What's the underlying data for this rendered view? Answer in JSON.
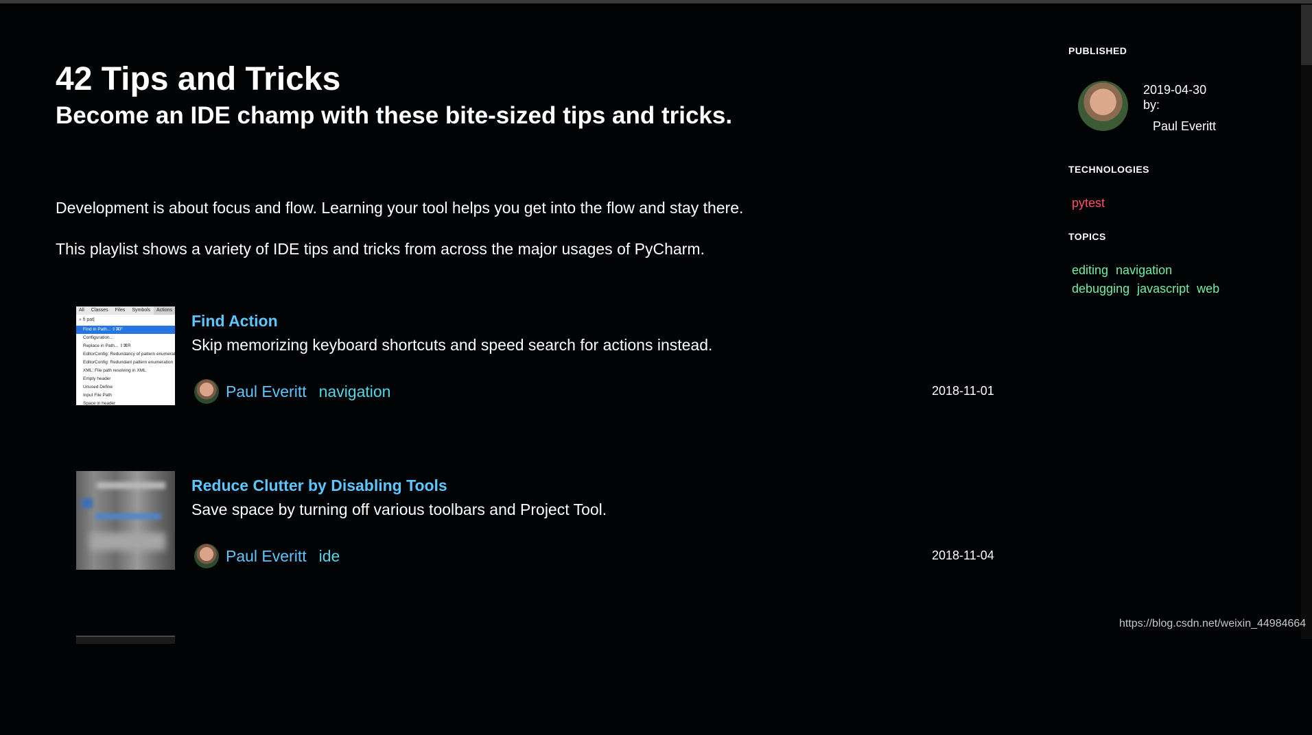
{
  "header": {
    "title": "42 Tips and Tricks",
    "subtitle": "Become an IDE champ with these bite-sized tips and tricks."
  },
  "intro": [
    "Development is about focus and flow. Learning your tool helps you get into the flow and stay there.",
    "This playlist shows a variety of IDE tips and tricks from across the major usages of PyCharm."
  ],
  "tips": [
    {
      "title": "Find Action",
      "description": "Skip memorizing keyboard shortcuts and speed search for actions instead.",
      "author": "Paul Everitt",
      "tag": "navigation",
      "date": "2018-11-01",
      "thumb": {
        "tabs": [
          "All",
          "Classes",
          "Files",
          "Symbols",
          "Actions"
        ],
        "search": "fi pat|",
        "rows": [
          "Find in Path...  ⇧⌘F",
          "Configuration...",
          "Replace in Path...  ⇧⌘R",
          "EditorConfig: Redundancy of pattern enumeration",
          "EditorConfig: Redundant pattern enumeration",
          "XML: File path resolving in XML",
          "Empty header",
          "Unused Define",
          "Input File Path",
          "Space in header"
        ]
      }
    },
    {
      "title": "Reduce Clutter by Disabling Tools",
      "description": "Save space by turning off various toolbars and Project Tool.",
      "author": "Paul Everitt",
      "tag": "ide",
      "date": "2018-11-04"
    }
  ],
  "sidebar": {
    "published_heading": "PUBLISHED",
    "published_date": "2019-04-30",
    "by_label": "by:",
    "author": "Paul Everitt",
    "technologies_heading": "TECHNOLOGIES",
    "technologies": [
      "pytest"
    ],
    "topics_heading": "TOPICS",
    "topics": [
      "editing",
      "navigation",
      "debugging",
      "javascript",
      "web"
    ]
  },
  "watermark": "https://blog.csdn.net/weixin_44984664",
  "colors": {
    "background": "#020305",
    "link_blue": "#5ec6ff",
    "tag_cyan": "#4fd8e8",
    "technology_red": "#ff4f6a",
    "topic_green": "#6ff0a6"
  },
  "icons": [
    "avatar",
    "scrollbar"
  ]
}
